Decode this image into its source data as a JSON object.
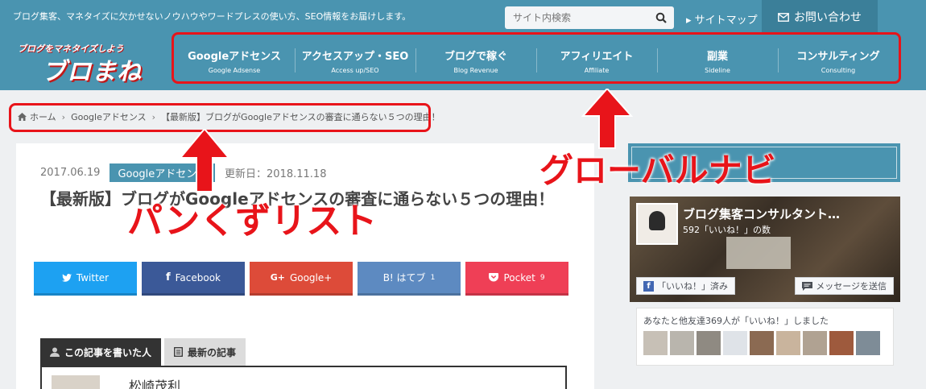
{
  "header": {
    "tagline": "ブログ集客、マネタイズに欠かせないノウハウやワードプレスの使い方、SEO情報をお届けします。",
    "search_placeholder": "サイト内検索",
    "sitemap_label": "サイトマップ",
    "contact_label": "お問い合わせ",
    "logo_small": "ブログをマネタイズしよう",
    "logo_big": "ブロまね"
  },
  "nav": {
    "items": [
      {
        "label": "Googleアドセンス",
        "sub": "Google Adsense"
      },
      {
        "label": "アクセスアップ・SEO",
        "sub": "Access up/SEO"
      },
      {
        "label": "ブログで稼ぐ",
        "sub": "Blog Revenue"
      },
      {
        "label": "アフィリエイト",
        "sub": "Affiliate"
      },
      {
        "label": "副業",
        "sub": "Sideline"
      },
      {
        "label": "コンサルティング",
        "sub": "Consulting"
      }
    ]
  },
  "breadcrumb": {
    "home": "ホーム",
    "category": "Googleアドセンス",
    "current": "【最新版】ブログがGoogleアドセンスの審査に通らない５つの理由！"
  },
  "article": {
    "date": "2017.06.19",
    "category": "Googleアドセンス",
    "updated": "更新日：2018.11.18",
    "title": "【最新版】ブログがGoogleアドセンスの審査に通らない５つの理由！"
  },
  "share": [
    {
      "label": "Twitter",
      "color": "#1da1f2"
    },
    {
      "label": "Facebook",
      "color": "#3b5998"
    },
    {
      "label": "Google+",
      "color": "#dd4b39"
    },
    {
      "label": "B! はてブ",
      "count": "1",
      "color": "#5d8ac1"
    },
    {
      "label": "Pocket",
      "count": "9",
      "color": "#ef3f56"
    }
  ],
  "author_tabs": {
    "active": "この記事を書いた人",
    "inactive": "最新の記事"
  },
  "author": {
    "name": "松崎茂利"
  },
  "sidebar": {
    "fb_name": "ブログ集客コンサルタント…",
    "fb_likes": "592「いいね！」の数",
    "fb_like_btn": "「いいね！」済み",
    "fb_msg_btn": "メッセージを送信",
    "fb_friends": "あなたと他友達369人が「いいね！」しました"
  },
  "annotations": {
    "breadcrumb_label": "パンくずリスト",
    "nav_label": "グローバルナビ"
  },
  "colors": {
    "header": "#4a94b0",
    "annotation_red": "#e8141a"
  }
}
